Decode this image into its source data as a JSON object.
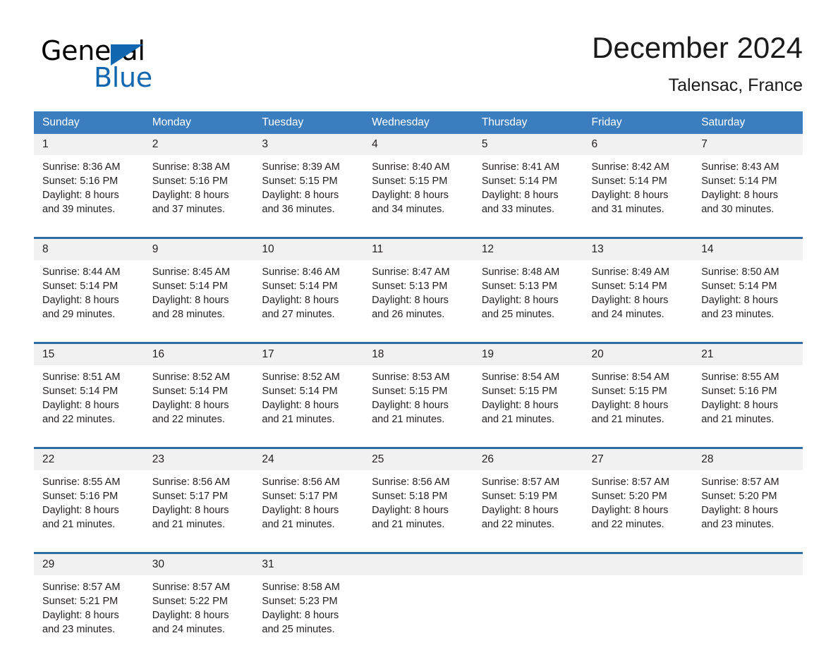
{
  "logo": {
    "word_one": "General",
    "word_two": "Blue",
    "accent_color": "#1168b0",
    "triangle_icon": "triangle-icon"
  },
  "header": {
    "title": "December 2024",
    "subtitle": "Talensac, France"
  },
  "theme": {
    "header_blue": "#3a7ebf",
    "separator_blue": "#2e6da4",
    "daynum_band": "#f1f1f1",
    "text": "#231f20"
  },
  "calendar": {
    "weekday_headers": [
      "Sunday",
      "Monday",
      "Tuesday",
      "Wednesday",
      "Thursday",
      "Friday",
      "Saturday"
    ],
    "weeks": [
      {
        "days": [
          {
            "num": "1",
            "detail": "Sunrise: 8:36 AM\nSunset: 5:16 PM\nDaylight: 8 hours\nand 39 minutes."
          },
          {
            "num": "2",
            "detail": "Sunrise: 8:38 AM\nSunset: 5:16 PM\nDaylight: 8 hours\nand 37 minutes."
          },
          {
            "num": "3",
            "detail": "Sunrise: 8:39 AM\nSunset: 5:15 PM\nDaylight: 8 hours\nand 36 minutes."
          },
          {
            "num": "4",
            "detail": "Sunrise: 8:40 AM\nSunset: 5:15 PM\nDaylight: 8 hours\nand 34 minutes."
          },
          {
            "num": "5",
            "detail": "Sunrise: 8:41 AM\nSunset: 5:14 PM\nDaylight: 8 hours\nand 33 minutes."
          },
          {
            "num": "6",
            "detail": "Sunrise: 8:42 AM\nSunset: 5:14 PM\nDaylight: 8 hours\nand 31 minutes."
          },
          {
            "num": "7",
            "detail": "Sunrise: 8:43 AM\nSunset: 5:14 PM\nDaylight: 8 hours\nand 30 minutes."
          }
        ]
      },
      {
        "days": [
          {
            "num": "8",
            "detail": "Sunrise: 8:44 AM\nSunset: 5:14 PM\nDaylight: 8 hours\nand 29 minutes."
          },
          {
            "num": "9",
            "detail": "Sunrise: 8:45 AM\nSunset: 5:14 PM\nDaylight: 8 hours\nand 28 minutes."
          },
          {
            "num": "10",
            "detail": "Sunrise: 8:46 AM\nSunset: 5:14 PM\nDaylight: 8 hours\nand 27 minutes."
          },
          {
            "num": "11",
            "detail": "Sunrise: 8:47 AM\nSunset: 5:13 PM\nDaylight: 8 hours\nand 26 minutes."
          },
          {
            "num": "12",
            "detail": "Sunrise: 8:48 AM\nSunset: 5:13 PM\nDaylight: 8 hours\nand 25 minutes."
          },
          {
            "num": "13",
            "detail": "Sunrise: 8:49 AM\nSunset: 5:14 PM\nDaylight: 8 hours\nand 24 minutes."
          },
          {
            "num": "14",
            "detail": "Sunrise: 8:50 AM\nSunset: 5:14 PM\nDaylight: 8 hours\nand 23 minutes."
          }
        ]
      },
      {
        "days": [
          {
            "num": "15",
            "detail": "Sunrise: 8:51 AM\nSunset: 5:14 PM\nDaylight: 8 hours\nand 22 minutes."
          },
          {
            "num": "16",
            "detail": "Sunrise: 8:52 AM\nSunset: 5:14 PM\nDaylight: 8 hours\nand 22 minutes."
          },
          {
            "num": "17",
            "detail": "Sunrise: 8:52 AM\nSunset: 5:14 PM\nDaylight: 8 hours\nand 21 minutes."
          },
          {
            "num": "18",
            "detail": "Sunrise: 8:53 AM\nSunset: 5:15 PM\nDaylight: 8 hours\nand 21 minutes."
          },
          {
            "num": "19",
            "detail": "Sunrise: 8:54 AM\nSunset: 5:15 PM\nDaylight: 8 hours\nand 21 minutes."
          },
          {
            "num": "20",
            "detail": "Sunrise: 8:54 AM\nSunset: 5:15 PM\nDaylight: 8 hours\nand 21 minutes."
          },
          {
            "num": "21",
            "detail": "Sunrise: 8:55 AM\nSunset: 5:16 PM\nDaylight: 8 hours\nand 21 minutes."
          }
        ]
      },
      {
        "days": [
          {
            "num": "22",
            "detail": "Sunrise: 8:55 AM\nSunset: 5:16 PM\nDaylight: 8 hours\nand 21 minutes."
          },
          {
            "num": "23",
            "detail": "Sunrise: 8:56 AM\nSunset: 5:17 PM\nDaylight: 8 hours\nand 21 minutes."
          },
          {
            "num": "24",
            "detail": "Sunrise: 8:56 AM\nSunset: 5:17 PM\nDaylight: 8 hours\nand 21 minutes."
          },
          {
            "num": "25",
            "detail": "Sunrise: 8:56 AM\nSunset: 5:18 PM\nDaylight: 8 hours\nand 21 minutes."
          },
          {
            "num": "26",
            "detail": "Sunrise: 8:57 AM\nSunset: 5:19 PM\nDaylight: 8 hours\nand 22 minutes."
          },
          {
            "num": "27",
            "detail": "Sunrise: 8:57 AM\nSunset: 5:20 PM\nDaylight: 8 hours\nand 22 minutes."
          },
          {
            "num": "28",
            "detail": "Sunrise: 8:57 AM\nSunset: 5:20 PM\nDaylight: 8 hours\nand 23 minutes."
          }
        ]
      },
      {
        "days": [
          {
            "num": "29",
            "detail": "Sunrise: 8:57 AM\nSunset: 5:21 PM\nDaylight: 8 hours\nand 23 minutes."
          },
          {
            "num": "30",
            "detail": "Sunrise: 8:57 AM\nSunset: 5:22 PM\nDaylight: 8 hours\nand 24 minutes."
          },
          {
            "num": "31",
            "detail": "Sunrise: 8:58 AM\nSunset: 5:23 PM\nDaylight: 8 hours\nand 25 minutes."
          },
          {
            "num": "",
            "detail": ""
          },
          {
            "num": "",
            "detail": ""
          },
          {
            "num": "",
            "detail": ""
          },
          {
            "num": "",
            "detail": ""
          }
        ]
      }
    ]
  }
}
